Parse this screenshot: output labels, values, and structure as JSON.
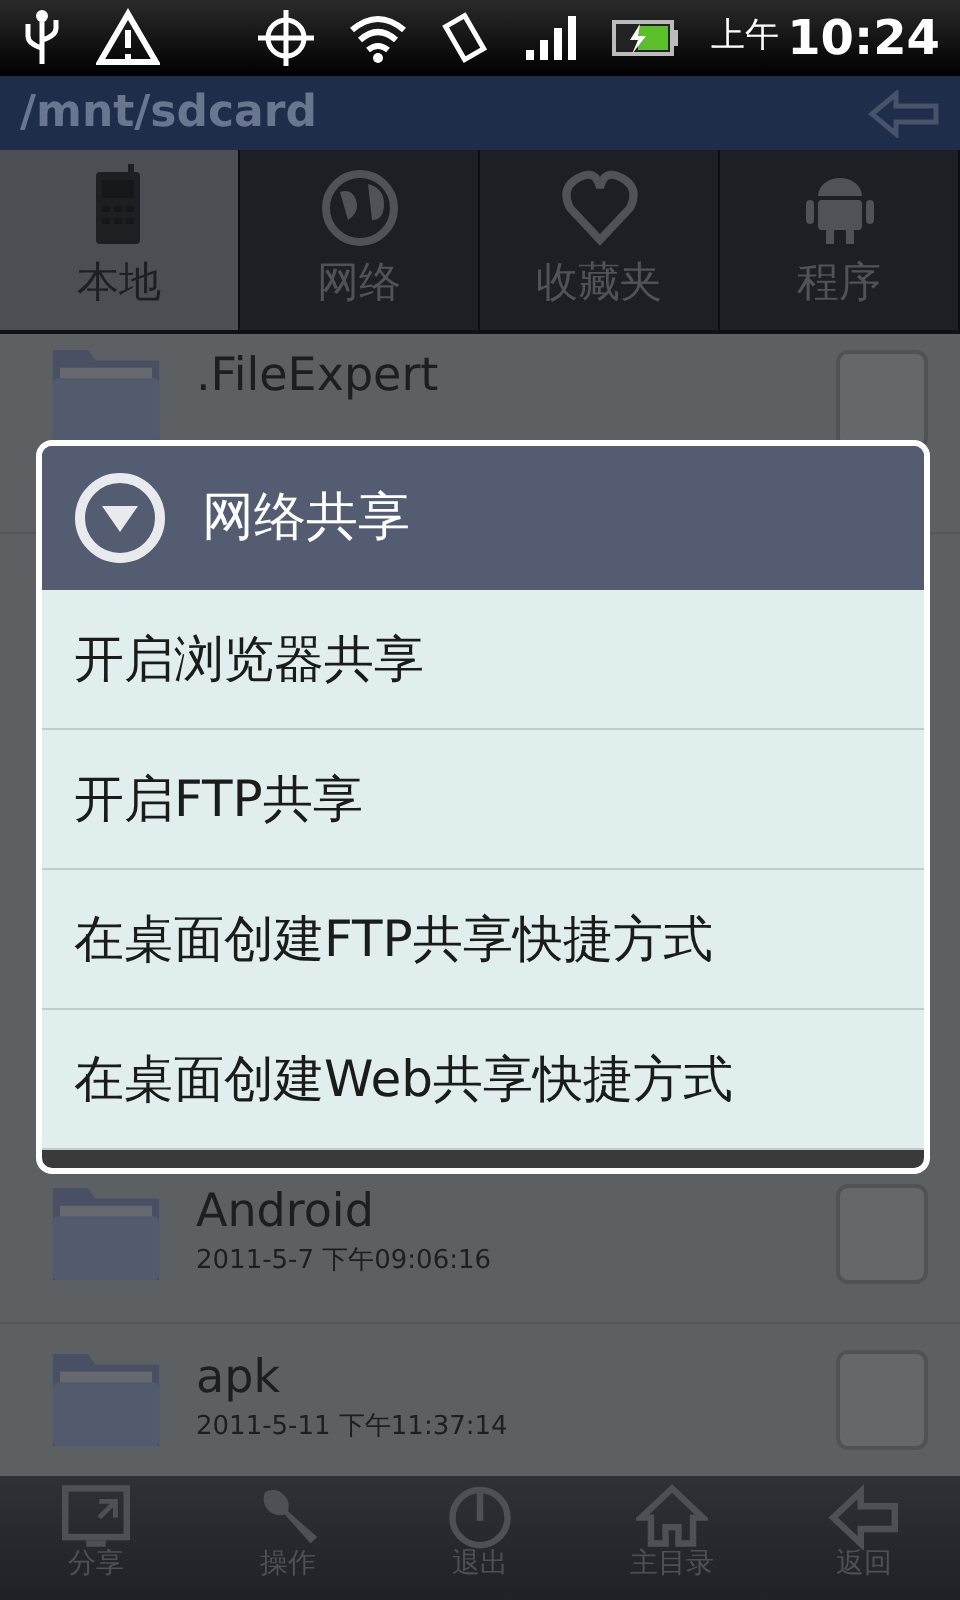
{
  "status_bar": {
    "am_pm": "上午",
    "time": "10:24"
  },
  "path_bar": {
    "path": "/mnt/sdcard"
  },
  "tabs": [
    {
      "label": "本地",
      "selected": true
    },
    {
      "label": "网络",
      "selected": false
    },
    {
      "label": "收藏夹",
      "selected": false
    },
    {
      "label": "程序",
      "selected": false
    }
  ],
  "files": [
    {
      "name": ".FileExpert",
      "checked": false
    },
    {
      "name": "Android",
      "date": "2011-5-7 下午09:06:16",
      "checked": false
    },
    {
      "name": "apk",
      "date": "2011-5-11 下午11:37:14",
      "checked": false
    }
  ],
  "dialog": {
    "title": "网络共享",
    "items": [
      "开启浏览器共享",
      "开启FTP共享",
      "在桌面创建FTP共享快捷方式",
      "在桌面创建Web共享快捷方式"
    ]
  },
  "toolbar": [
    {
      "label": "分享"
    },
    {
      "label": "操作"
    },
    {
      "label": "退出"
    },
    {
      "label": "主目录"
    },
    {
      "label": "返回"
    }
  ]
}
